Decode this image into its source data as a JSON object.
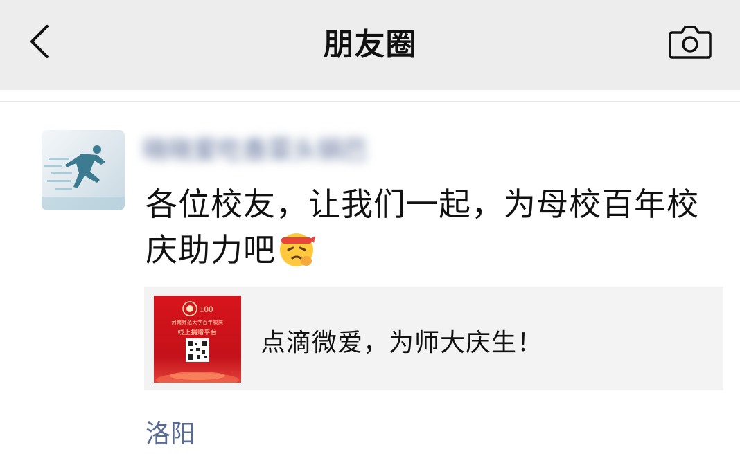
{
  "navbar": {
    "title": "朋友圈",
    "back_icon": "chevron-left-icon",
    "camera_icon": "camera-icon"
  },
  "post": {
    "avatar_icon": "runner-avatar",
    "nickname": "晓晓爱吃香菜头锅巴",
    "text": "各位校友，让我们一起，为母校百年校庆助力吧",
    "emoji": "salute-face-emoji",
    "link_card": {
      "thumbnail_line1": "河南师范大学百年校庆",
      "thumbnail_line2": "线上捐赠平台",
      "title": "点滴微爱，为师大庆生！"
    },
    "location": "洛阳"
  },
  "colors": {
    "navbar_bg": "#ededed",
    "link_blue": "#576b95",
    "card_bg": "#f3f3f3",
    "thumb_red": "#d8141b"
  }
}
